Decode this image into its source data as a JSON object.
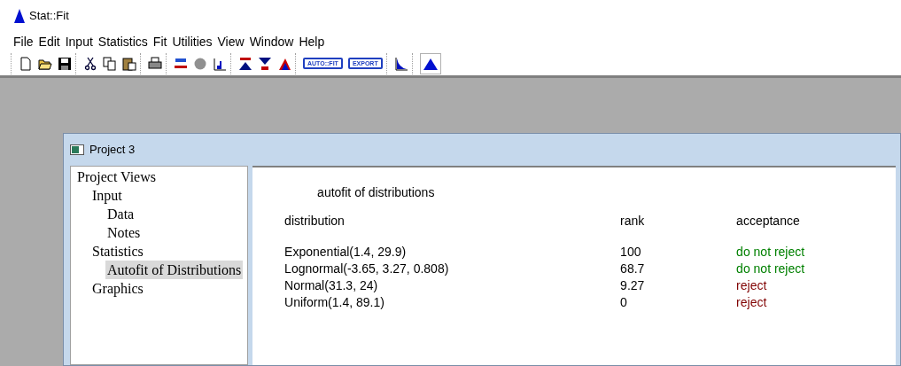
{
  "app": {
    "title": "Stat::Fit"
  },
  "menu": [
    "File",
    "Edit",
    "Input",
    "Statistics",
    "Fit",
    "Utilities",
    "View",
    "Window",
    "Help"
  ],
  "toolbar": {
    "groups": [
      [
        {
          "kind": "new"
        },
        {
          "kind": "open"
        },
        {
          "kind": "save"
        }
      ],
      [
        {
          "kind": "cut"
        },
        {
          "kind": "copy"
        },
        {
          "kind": "paste"
        }
      ],
      [
        {
          "kind": "print"
        }
      ],
      [
        {
          "kind": "ops"
        },
        {
          "kind": "circle"
        },
        {
          "kind": "histogram"
        }
      ],
      [
        {
          "kind": "setup"
        },
        {
          "kind": "fit"
        },
        {
          "kind": "triangle"
        }
      ],
      [
        {
          "kind": "wide",
          "label": "AUTO::FIT"
        },
        {
          "kind": "wide",
          "label": "EXPORT"
        }
      ],
      [
        {
          "kind": "decay"
        }
      ],
      [
        {
          "kind": "mountain",
          "selected": true
        }
      ]
    ]
  },
  "project_window": {
    "title": "Project 3",
    "tree": [
      {
        "label": "Project Views",
        "selected": false,
        "children": [
          {
            "label": "Input",
            "selected": false,
            "children": [
              {
                "label": "Data",
                "selected": false
              },
              {
                "label": "Notes",
                "selected": false
              }
            ]
          },
          {
            "label": "Statistics",
            "selected": false,
            "children": [
              {
                "label": "Autofit of Distributions",
                "selected": true
              }
            ]
          },
          {
            "label": "Graphics",
            "selected": false
          }
        ]
      }
    ],
    "report": {
      "heading": "autofit of distributions",
      "columns": [
        "distribution",
        "rank",
        "acceptance"
      ],
      "rows": [
        {
          "distribution": "Exponential(1.4, 29.9)",
          "rank": "100",
          "acceptance": "do not reject",
          "color": "#008000"
        },
        {
          "distribution": "Lognormal(-3.65, 3.27, 0.808)",
          "rank": "68.7",
          "acceptance": "do not reject",
          "color": "#008000"
        },
        {
          "distribution": "Normal(31.3, 24)",
          "rank": "9.27",
          "acceptance": "reject",
          "color": "#800000"
        },
        {
          "distribution": "Uniform(1.4, 89.1)",
          "rank": "0",
          "acceptance": "reject",
          "color": "#800000"
        }
      ]
    }
  }
}
